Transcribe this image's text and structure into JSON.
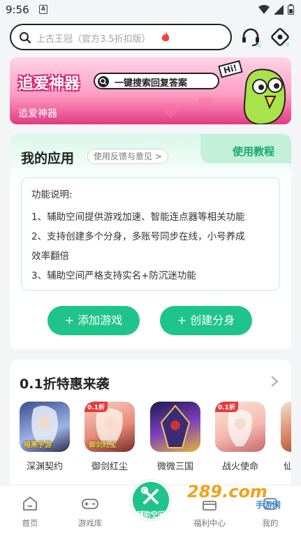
{
  "status_bar": {
    "time": "9:56",
    "notification_badge": "A"
  },
  "search": {
    "placeholder": "上古王冠（官方3.5折扣版）"
  },
  "banner": {
    "title": "追爱神器",
    "pill_text": "一键搜索回复答案",
    "hi_badge": "Hi!",
    "caption": "追爱神器"
  },
  "apps": {
    "title": "我的应用",
    "feedback_label": "使用反馈与意见 >",
    "tutorial_label": "使用教程",
    "description_title": "功能说明:",
    "description_lines": [
      "1、辅助空间提供游戏加速、智能连点器等相关功能",
      "2、支持创建多个分身，多账号同步在线，小号养成",
      "效率翻倍",
      "3、辅助空间严格支持实名+防沉迷功能"
    ],
    "add_game_label": "+ 添加游戏",
    "create_clone_label": "+ 创建分身"
  },
  "deals": {
    "title": "0.1折特惠来袭",
    "games": [
      {
        "name": "深渊契约",
        "badge": "",
        "thumb_text": "暗黑手游"
      },
      {
        "name": "御剑红尘",
        "badge": "0.1折",
        "thumb_text": "御剑红尘"
      },
      {
        "name": "微微三国",
        "badge": "",
        "thumb_text": ""
      },
      {
        "name": "战火使命",
        "badge": "0.1折",
        "thumb_text": ""
      },
      {
        "name": "仙",
        "badge": "",
        "thumb_text": ""
      }
    ]
  },
  "bottom_nav": {
    "home": "首页",
    "game_library": "游戏库",
    "assist_space": "辅助空间",
    "welfare": "福利中心",
    "mine": "我的"
  },
  "watermark": {
    "text": "289.com",
    "sub": "手游网"
  },
  "colors": {
    "accent_green": "#1fc48a",
    "banner_pink": "#e03a82"
  }
}
